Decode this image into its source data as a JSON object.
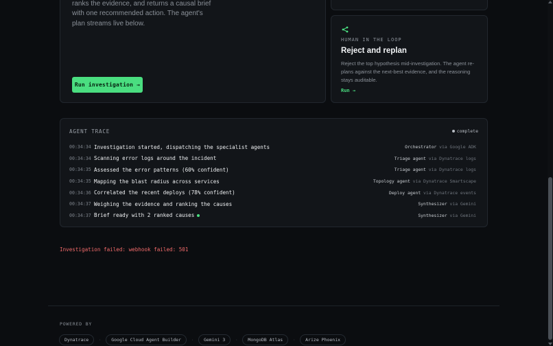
{
  "investigation": {
    "description": "ranks the evidence, and returns a causal brief with one recommended action. The agent's plan streams live below.",
    "run_button": "Run investigation →"
  },
  "human_in_loop": {
    "icon": "share-branch-icon",
    "eyebrow": "HUMAN IN THE LOOP",
    "title": "Reject and replan",
    "description": "Reject the top hypothesis mid-investigation. The agent re-plans against the next-best evidence, and the reasoning stays auditable.",
    "run_link": "Run →"
  },
  "trace": {
    "title": "AGENT TRACE",
    "status": "complete",
    "rows": [
      {
        "time": "00:34:34",
        "message": "Investigation started, dispatching the specialist agents",
        "agent": "Orchestrator",
        "via": "via Google ADK"
      },
      {
        "time": "00:34:34",
        "message": "Scanning error logs around the incident",
        "agent": "Triage agent",
        "via": "via Dynatrace logs"
      },
      {
        "time": "00:34:35",
        "message": "Assessed the error patterns (60% confident)",
        "agent": "Triage agent",
        "via": "via Dynatrace logs"
      },
      {
        "time": "00:34:35",
        "message": "Mapping the blast radius across services",
        "agent": "Topology agent",
        "via": "via Dynatrace Smartscape"
      },
      {
        "time": "00:34:36",
        "message": "Correlated the recent deploys (78% confident)",
        "agent": "Deploy agent",
        "via": "via Dynatrace events"
      },
      {
        "time": "00:34:37",
        "message": "Weighing the evidence and ranking the causes",
        "agent": "Synthesizer",
        "via": "via Gemini"
      },
      {
        "time": "00:34:37",
        "message": "Brief ready with 2 ranked causes",
        "agent": "Synthesizer",
        "via": "via Gemini"
      }
    ]
  },
  "error": "Investigation failed: webhook failed: 501",
  "footer": {
    "powered_by": "POWERED BY",
    "partners": [
      "Dynatrace",
      "Google Cloud Agent Builder",
      "Gemini 3",
      "MongoDB Atlas",
      "Arize Phoenix"
    ]
  },
  "colors": {
    "accent": "#4ade80",
    "error": "#f26b6b",
    "background": "#0b0d10"
  }
}
